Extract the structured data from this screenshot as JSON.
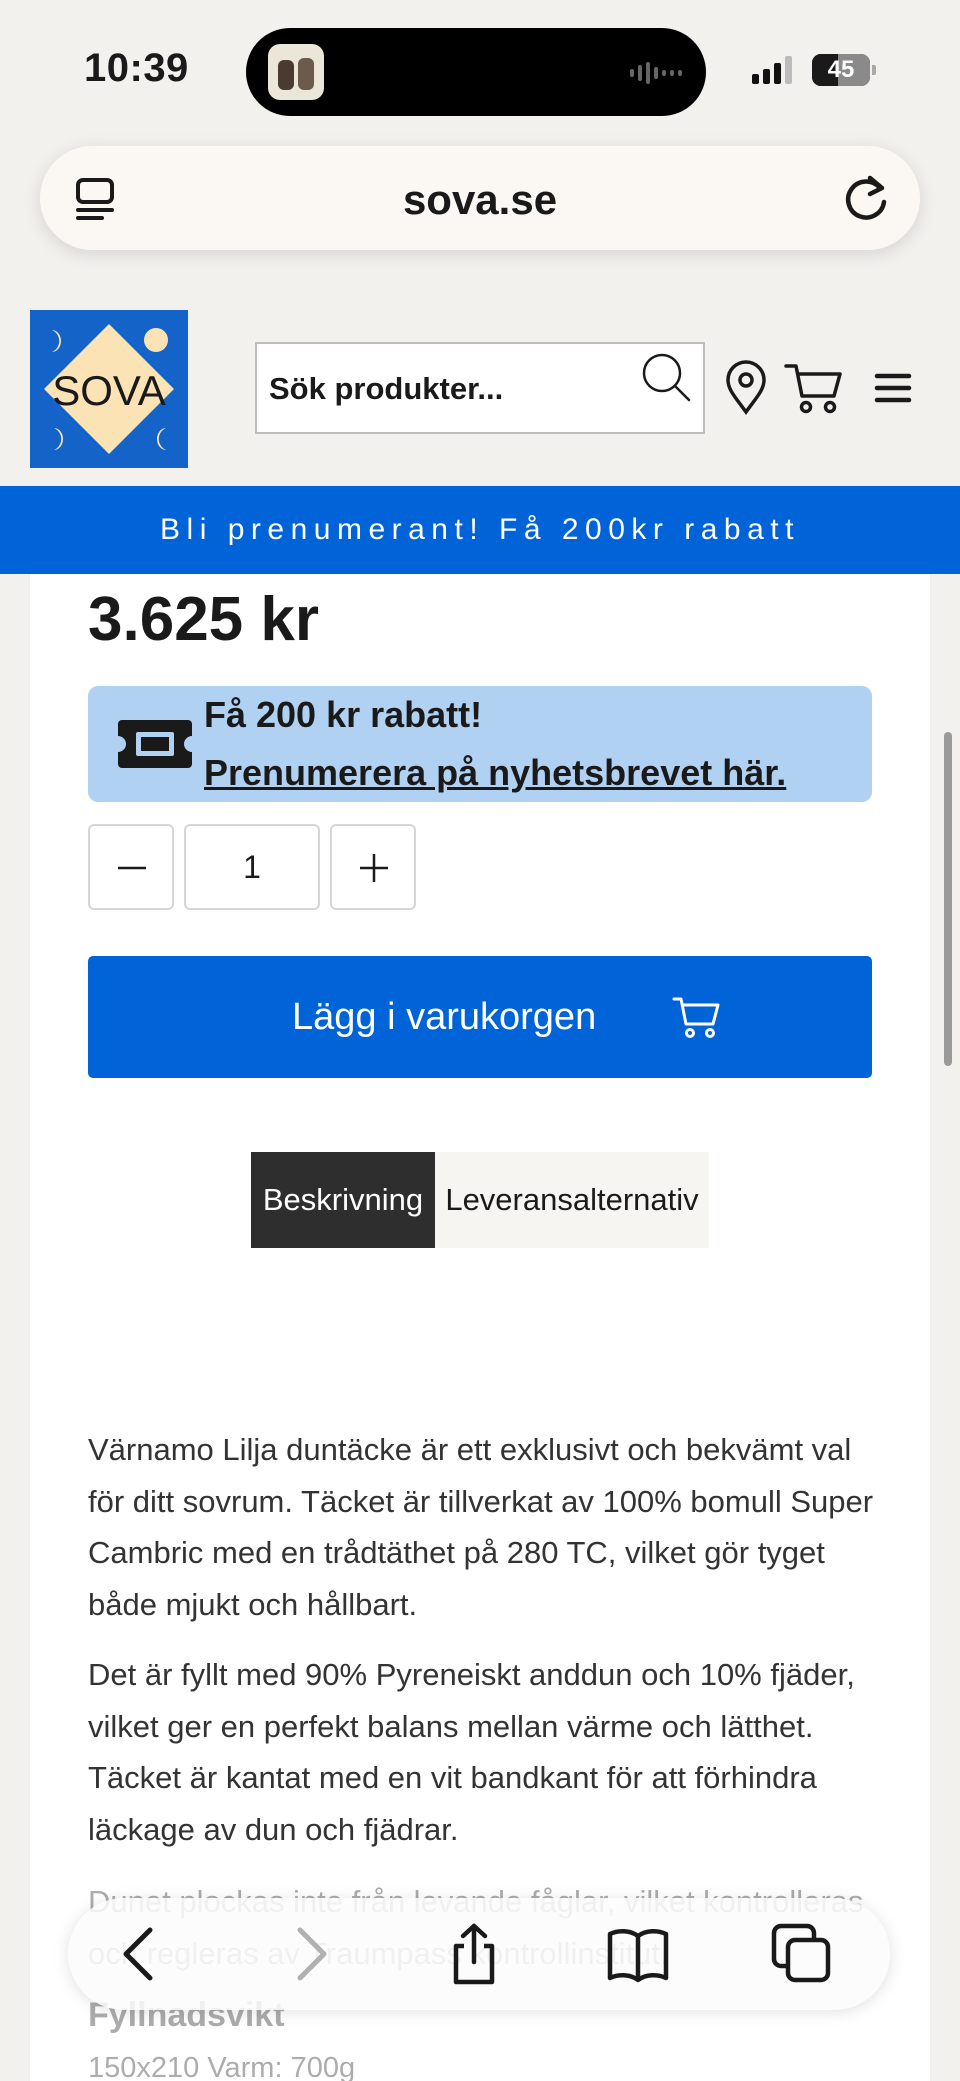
{
  "status_bar": {
    "time": "10:39",
    "battery": "45"
  },
  "browser": {
    "url": "sova.se"
  },
  "header": {
    "logo_text": "SOVA",
    "search_placeholder": "Sök produkter..."
  },
  "promo_banner": "Bli prenumerant! Få 200kr rabatt",
  "product": {
    "price": "3.625 kr",
    "coupon_title": "Få 200 kr rabatt!",
    "coupon_link": "Prenumerera på nyhetsbrevet här.",
    "quantity": "1",
    "add_to_cart": "Lägg i varukorgen"
  },
  "tabs": {
    "description": "Beskrivning",
    "delivery": "Leveransalternativ",
    "active": "Beskrivning"
  },
  "description": {
    "p1": "Värnamo Lilja duntäcke är ett exklusivt och bekvämt val för ditt sovrum. Täcket är tillverkat av 100% bomull Super Cambric med en trådtäthet på 280 TC, vilket gör tyget både mjukt och hållbart.",
    "p2": "Det är fyllt med 90% Pyreneiskt anddun och 10% fjäder, vilket ger en perfekt balans mellan värme och lätthet. Täcket är kantat med en vit bandkant för att förhindra läckage av dun och fjädrar.",
    "p3": "Dunet plockas inte från levande fåglar, vilket kontrolleras och regleras av Traumpass kontrollinstitut.",
    "fill_heading": "Fyllnadsvikt",
    "fill_value": "150x210 Varm: 700g"
  },
  "colors": {
    "brand_blue": "#0063d8",
    "coupon_bg": "#b1d1f3",
    "logo_yellow": "#fbe3b5",
    "tab_active": "#2e2e2e"
  }
}
